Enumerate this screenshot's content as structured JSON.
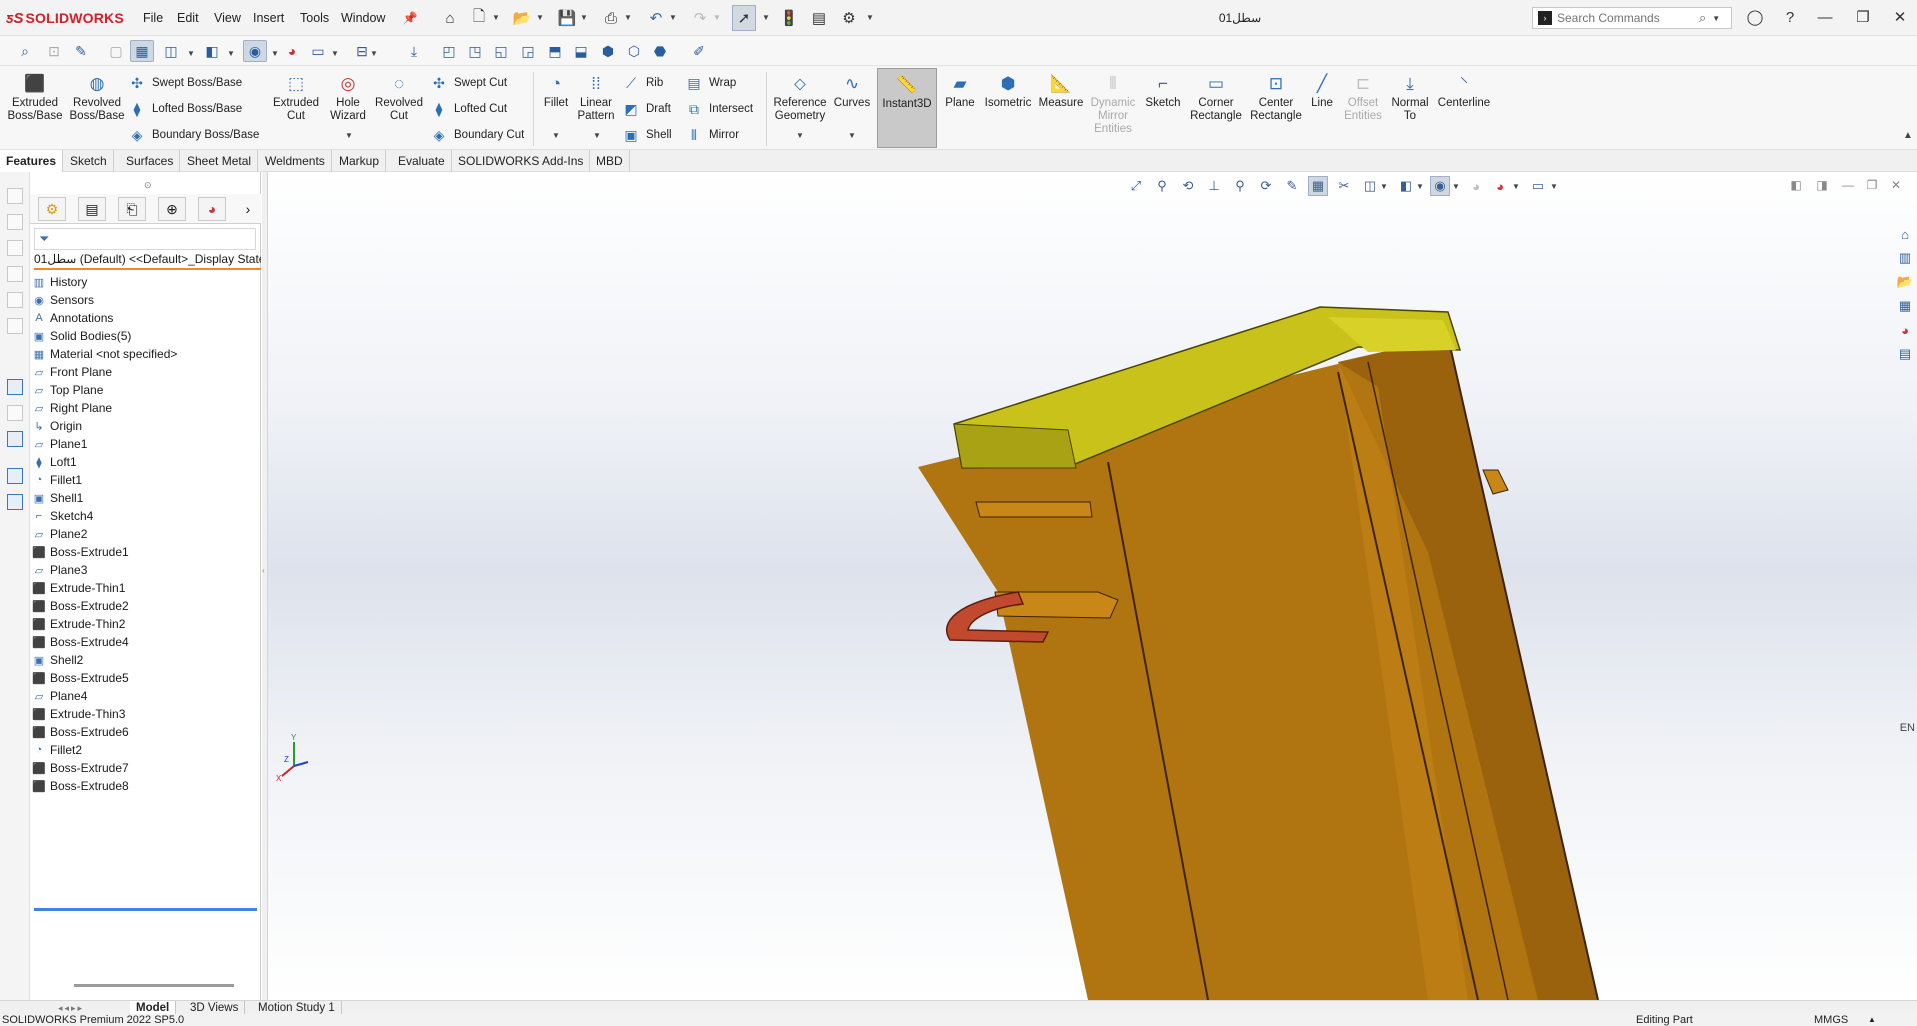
{
  "app": {
    "brand": "SOLIDWORKS",
    "brand_color": "#d0202a",
    "document_title": "سطل01",
    "menu": [
      "File",
      "Edit",
      "View",
      "Insert",
      "Tools",
      "Window"
    ]
  },
  "search": {
    "placeholder": "Search Commands"
  },
  "command_manager": {
    "extruded_boss": "Extruded\nBoss/Base",
    "revolved_boss": "Revolved\nBoss/Base",
    "swept_boss": "Swept Boss/Base",
    "lofted_boss": "Lofted Boss/Base",
    "boundary_boss": "Boundary Boss/Base",
    "extruded_cut": "Extruded\nCut",
    "hole_wizard": "Hole\nWizard",
    "revolved_cut": "Revolved\nCut",
    "swept_cut": "Swept Cut",
    "lofted_cut": "Lofted Cut",
    "boundary_cut": "Boundary Cut",
    "fillet": "Fillet",
    "linear_pattern": "Linear\nPattern",
    "rib": "Rib",
    "draft": "Draft",
    "shell": "Shell",
    "wrap": "Wrap",
    "intersect": "Intersect",
    "mirror": "Mirror",
    "reference_geometry": "Reference\nGeometry",
    "curves": "Curves",
    "instant3d": "Instant3D",
    "plane": "Plane",
    "isometric": "Isometric",
    "measure": "Measure",
    "dynamic_mirror": "Dynamic\nMirror\nEntities",
    "sketch": "Sketch",
    "corner_rectangle": "Corner\nRectangle",
    "center_rectangle": "Center\nRectangle",
    "line": "Line",
    "offset_entities": "Offset\nEntities",
    "normal_to": "Normal\nTo",
    "centerline": "Centerline"
  },
  "command_tabs": [
    "Features",
    "Sketch",
    "Surfaces",
    "Sheet Metal",
    "Weldments",
    "Markup",
    "Evaluate",
    "SOLIDWORKS Add-Ins",
    "MBD"
  ],
  "active_command_tab": "Features",
  "feature_tree": {
    "root": "سطل01 (Default) <<Default>_Display State 1>",
    "items": [
      "History",
      "Sensors",
      "Annotations",
      "Solid Bodies(5)",
      "Material <not specified>",
      "Front Plane",
      "Top Plane",
      "Right Plane",
      "Origin",
      "Plane1",
      "Loft1",
      "Fillet1",
      "Shell1",
      "Sketch4",
      "Plane2",
      "Boss-Extrude1",
      "Plane3",
      "Extrude-Thin1",
      "Boss-Extrude2",
      "Extrude-Thin2",
      "Boss-Extrude4",
      "Shell2",
      "Boss-Extrude5",
      "Plane4",
      "Extrude-Thin3",
      "Boss-Extrude6",
      "Fillet2",
      "Boss-Extrude7",
      "Boss-Extrude8"
    ]
  },
  "viewport": {
    "language_indicator": "EN",
    "triad": {
      "y": "Y",
      "x": "X",
      "z": "Z"
    },
    "model_colors": {
      "body": "#b07410",
      "body_dark": "#8a5a0a",
      "lid": "#c8c21a",
      "handle": "#c0492e"
    }
  },
  "bottom_tabs": [
    "Model",
    "3D Views",
    "Motion Study 1"
  ],
  "active_bottom_tab": "Model",
  "status": {
    "product": "SOLIDWORKS Premium 2022 SP5.0",
    "mode": "Editing Part",
    "units": "MMGS"
  }
}
